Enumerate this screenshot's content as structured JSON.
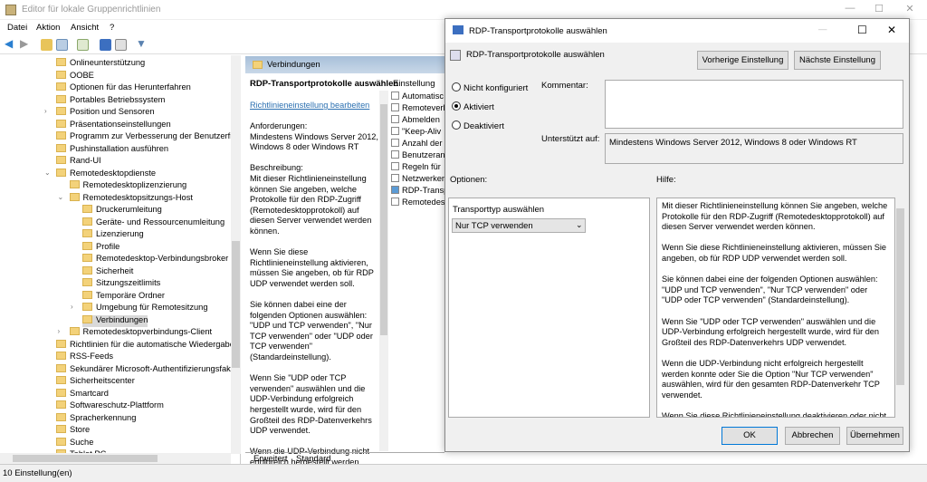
{
  "window": {
    "title": "Editor für lokale Gruppenrichtlinien"
  },
  "menu": [
    "Datei",
    "Aktion",
    "Ansicht",
    "?"
  ],
  "tree": [
    {
      "label": "Onlineunterstützung",
      "level": 0
    },
    {
      "label": "OOBE",
      "level": 0
    },
    {
      "label": "Optionen für das Herunterfahren",
      "level": 0
    },
    {
      "label": "Portables Betriebssystem",
      "level": 0
    },
    {
      "label": "Position und Sensoren",
      "level": 0,
      "expander": "collapsed"
    },
    {
      "label": "Präsentationseinstellungen",
      "level": 0
    },
    {
      "label": "Programm zur Verbesserung der Benutzerfreu",
      "level": 0
    },
    {
      "label": "Pushinstallation ausführen",
      "level": 0
    },
    {
      "label": "Rand-UI",
      "level": 0
    },
    {
      "label": "Remotedesktopdienste",
      "level": 0,
      "expander": "expanded"
    },
    {
      "label": "Remotedesktoplizenzierung",
      "level": 1
    },
    {
      "label": "Remotedesktopsitzungs-Host",
      "level": 1,
      "expander": "expanded"
    },
    {
      "label": "Druckerumleitung",
      "level": 2
    },
    {
      "label": "Geräte- und Ressourcenumleitung",
      "level": 2
    },
    {
      "label": "Lizenzierung",
      "level": 2
    },
    {
      "label": "Profile",
      "level": 2
    },
    {
      "label": "Remotedesktop-Verbindungsbroker",
      "level": 2
    },
    {
      "label": "Sicherheit",
      "level": 2
    },
    {
      "label": "Sitzungszeitlimits",
      "level": 2
    },
    {
      "label": "Temporäre Ordner",
      "level": 2
    },
    {
      "label": "Umgebung für Remotesitzung",
      "level": 2,
      "expander": "collapsed"
    },
    {
      "label": "Verbindungen",
      "level": 2,
      "selected": true
    },
    {
      "label": "Remotedesktopverbindungs-Client",
      "level": 1,
      "expander": "collapsed"
    },
    {
      "label": "Richtlinien für die automatische Wiedergabe",
      "level": 0
    },
    {
      "label": "RSS-Feeds",
      "level": 0
    },
    {
      "label": "Sekundärer Microsoft-Authentifizierungsfakt",
      "level": 0
    },
    {
      "label": "Sicherheitscenter",
      "level": 0
    },
    {
      "label": "Smartcard",
      "level": 0
    },
    {
      "label": "Softwareschutz-Plattform",
      "level": 0
    },
    {
      "label": "Spracherkennung",
      "level": 0
    },
    {
      "label": "Store",
      "level": 0
    },
    {
      "label": "Suche",
      "level": 0
    },
    {
      "label": "Tablet PC",
      "level": 0
    }
  ],
  "status": "10 Einstellung(en)",
  "middle": {
    "header": "Verbindungen",
    "title": "RDP-Transportprotokolle auswählen",
    "edit_link": "Richtlinieneinstellung bearbeiten",
    "description": "Anforderungen:\nMindestens Windows Server 2012, Windows 8 oder Windows RT\n\nBeschreibung:\nMit dieser Richtlinieneinstellung können Sie angeben, welche Protokolle für den RDP-Zugriff (Remotedesktopprotokoll) auf diesen Server verwendet werden können.\n\nWenn Sie diese Richtlinieneinstellung aktivieren, müssen Sie angeben, ob für RDP UDP verwendet werden soll.\n\nSie können dabei eine der folgenden Optionen auswählen: \"UDP und TCP verwenden\", \"Nur TCP verwenden\" oder \"UDP oder TCP verwenden\" (Standardeinstellung).\n\nWenn Sie \"UDP oder TCP verwenden\" auswählen und die UDP-Verbindung erfolgreich hergestellt wurde, wird für den Großteil des RDP-Datenverkehrs UDP verwendet.\n\nWenn die UDP-Verbindung nicht erfolgreich hergestellt werden",
    "column": "Einstellung",
    "settings": [
      "Automatisc",
      "Remoteverl",
      "Abmelden",
      "\"Keep-Aliv",
      "Anzahl der",
      "Benutzeran",
      "Regeln für",
      "Netzwerker",
      "RDP-Transp",
      "Remotedes"
    ],
    "tabs": [
      "Erweitert",
      "Standard"
    ]
  },
  "dialog": {
    "title": "RDP-Transportprotokolle auswählen",
    "header": "RDP-Transportprotokolle auswählen",
    "prev_button": "Vorherige Einstellung",
    "next_button": "Nächste Einstellung",
    "radios": [
      "Nicht konfiguriert",
      "Aktiviert",
      "Deaktiviert"
    ],
    "selected_radio": "Aktiviert",
    "comment_label": "Kommentar:",
    "comment_value": "",
    "supported_label": "Unterstützt auf:",
    "supported_value": "Mindestens Windows Server 2012, Windows 8 oder Windows RT",
    "options_label": "Optionen:",
    "help_label": "Hilfe:",
    "transport_label": "Transporttyp auswählen",
    "transport_value": "Nur TCP verwenden",
    "help_text": "Mit dieser Richtlinieneinstellung können Sie angeben, welche Protokolle für den RDP-Zugriff (Remotedesktopprotokoll) auf diesen Server verwendet werden können.\n\nWenn Sie diese Richtlinieneinstellung aktivieren, müssen Sie angeben, ob für RDP UDP verwendet werden soll.\n\nSie können dabei eine der folgenden Optionen auswählen: \"UDP und TCP verwenden\", \"Nur TCP verwenden\" oder \"UDP oder TCP verwenden\" (Standardeinstellung).\n\nWenn Sie \"UDP oder TCP verwenden\" auswählen und die UDP-Verbindung erfolgreich hergestellt wurde, wird für den Großteil des RDP-Datenverkehrs UDP verwendet.\n\nWenn die UDP-Verbindung nicht erfolgreich hergestellt werden konnte oder Sie die Option \"Nur TCP verwenden\" auswählen, wird für den gesamten RDP-Datenverkehr TCP verwendet.\n\nWenn Sie diese Richtlinieneinstellung deaktivieren oder nicht konfigurieren, werden von RDP die optimalen Protokolle für die",
    "ok": "OK",
    "cancel": "Abbrechen",
    "apply": "Übernehmen"
  }
}
